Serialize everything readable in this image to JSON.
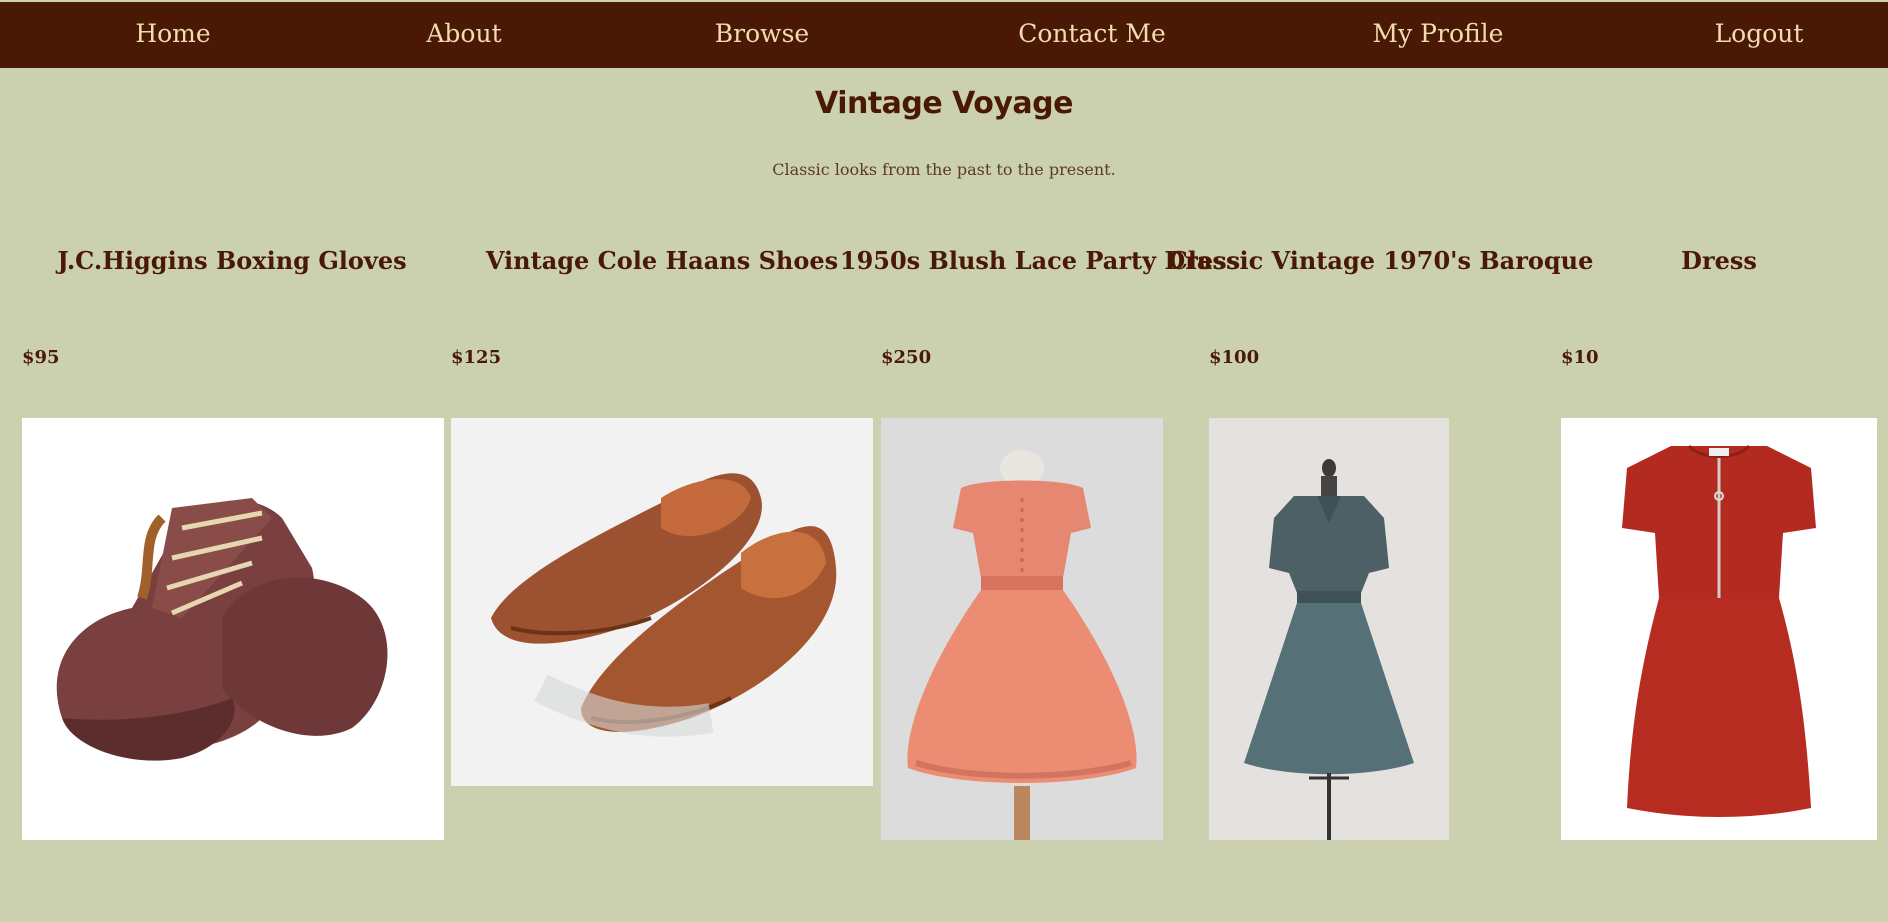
{
  "nav": {
    "items": [
      {
        "label": "Home"
      },
      {
        "label": "About"
      },
      {
        "label": "Browse"
      },
      {
        "label": "Contact Me"
      },
      {
        "label": "My Profile"
      },
      {
        "label": "Logout"
      }
    ]
  },
  "header": {
    "title": "Vintage Voyage",
    "tagline": "Classic looks from the past to the present."
  },
  "products": [
    {
      "title": "J.C.Higgins Boxing Gloves",
      "price": "$95",
      "image": "boxing-gloves"
    },
    {
      "title": "Vintage Cole Haans Shoes",
      "price": "$125",
      "image": "leather-loafers"
    },
    {
      "title": "1950s Blush Lace Party Dress",
      "price": "$250",
      "image": "blush-lace-dress"
    },
    {
      "title": "Classic Vintage 1970's Baroque",
      "price": "$100",
      "image": "blue-shirt-dress"
    },
    {
      "title": "Dress",
      "price": "$10",
      "image": "red-zip-dress"
    }
  ],
  "colors": {
    "nav_bg": "#4a1906",
    "nav_text": "#f2dcae",
    "page_bg": "#cbd0ae",
    "heading": "#4a1906"
  }
}
